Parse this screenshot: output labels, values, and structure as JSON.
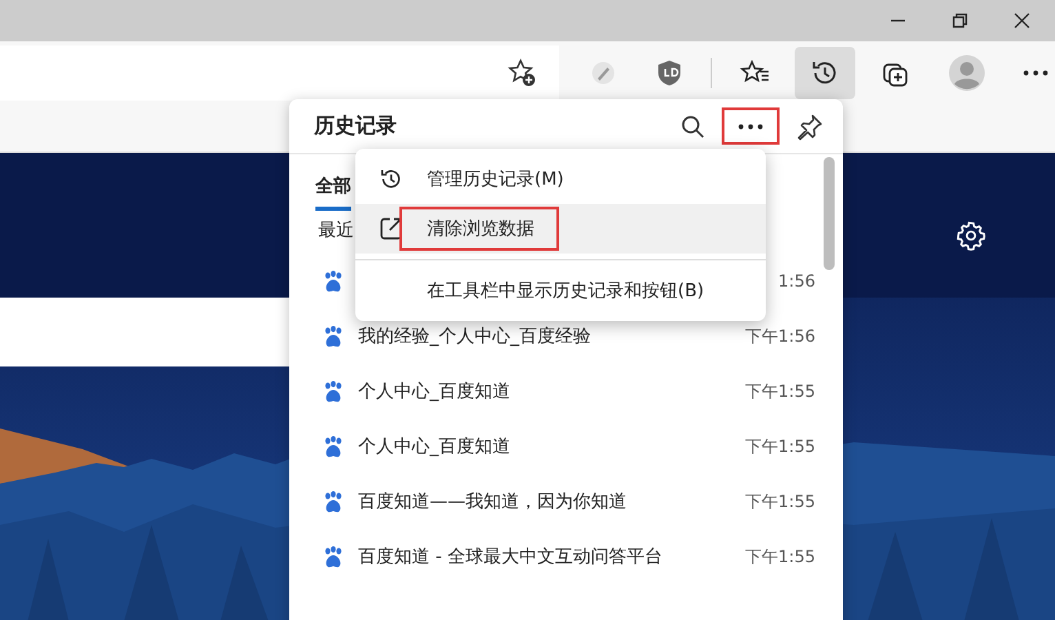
{
  "toolbar": {
    "history_button": {
      "selected": true
    }
  },
  "history_panel": {
    "title": "历史记录",
    "more_button": {
      "highlighted": true
    },
    "tabs": [
      {
        "label": "全部",
        "selected": true
      }
    ],
    "section": "最近",
    "rows": [
      {
        "title": "",
        "time": "1:56"
      },
      {
        "title": "我的经验_个人中心_百度经验",
        "time": "下午1:56"
      },
      {
        "title": "个人中心_百度知道",
        "time": "下午1:55"
      },
      {
        "title": "个人中心_百度知道",
        "time": "下午1:55"
      },
      {
        "title": "百度知道——我知道，因为你知道",
        "time": "下午1:55"
      },
      {
        "title": "百度知道 - 全球最大中文互动问答平台",
        "time": "下午1:55"
      }
    ]
  },
  "menu": {
    "items": [
      {
        "kind": "history",
        "label": "管理历史记录(M)",
        "hovered": false,
        "highlighted": false,
        "separator_before": false
      },
      {
        "kind": "external",
        "label": "清除浏览数据",
        "hovered": true,
        "highlighted": true,
        "separator_before": false
      },
      {
        "kind": "plain",
        "label": "在工具栏中显示历史记录和按钮(B)",
        "hovered": false,
        "highlighted": false,
        "separator_before": true
      }
    ]
  }
}
